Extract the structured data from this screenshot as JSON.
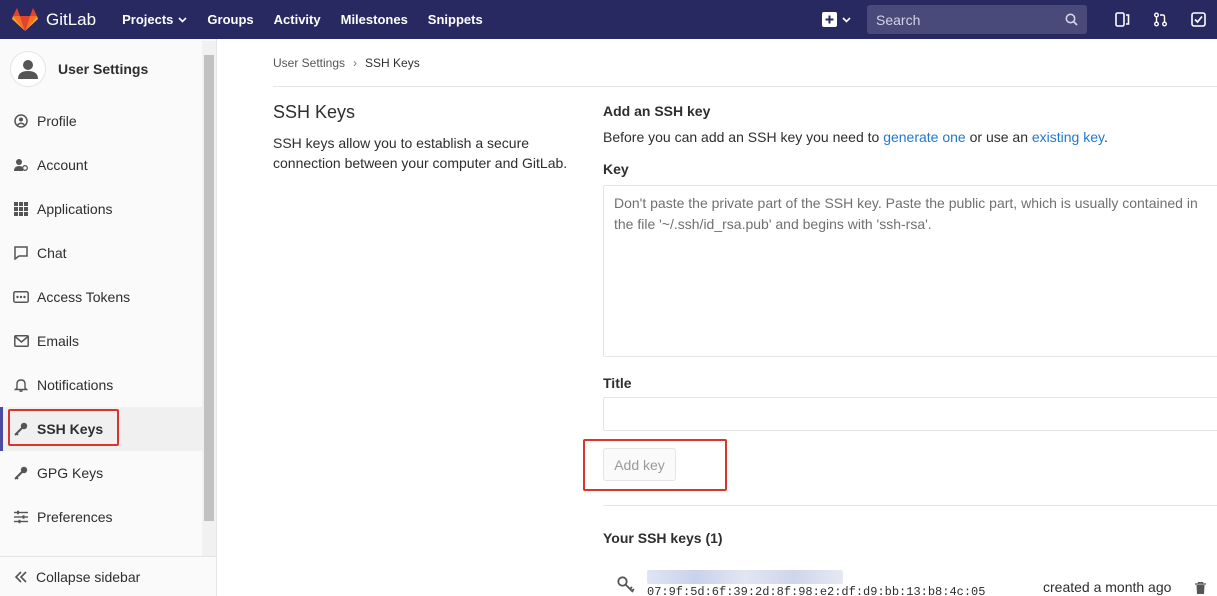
{
  "topnav": {
    "brand": "GitLab",
    "links": [
      {
        "label": "Projects",
        "has_dropdown": true
      },
      {
        "label": "Groups"
      },
      {
        "label": "Activity"
      },
      {
        "label": "Milestones"
      },
      {
        "label": "Snippets"
      }
    ],
    "search_placeholder": "Search",
    "colors": {
      "background": "#292961",
      "logo": "#e2432a"
    }
  },
  "sidebar": {
    "title": "User Settings",
    "items": [
      {
        "label": "Profile",
        "icon": "profile-icon"
      },
      {
        "label": "Account",
        "icon": "account-icon"
      },
      {
        "label": "Applications",
        "icon": "applications-icon"
      },
      {
        "label": "Chat",
        "icon": "chat-icon"
      },
      {
        "label": "Access Tokens",
        "icon": "token-icon"
      },
      {
        "label": "Emails",
        "icon": "email-icon"
      },
      {
        "label": "Notifications",
        "icon": "bell-icon"
      },
      {
        "label": "SSH Keys",
        "icon": "key-icon",
        "active": true
      },
      {
        "label": "GPG Keys",
        "icon": "key-icon"
      },
      {
        "label": "Preferences",
        "icon": "preferences-icon"
      }
    ],
    "collapse_label": "Collapse sidebar"
  },
  "breadcrumb": {
    "parent": "User Settings",
    "separator": "›",
    "current": "SSH Keys"
  },
  "intro": {
    "title": "SSH Keys",
    "description": "SSH keys allow you to establish a secure connection between your computer and GitLab."
  },
  "form": {
    "heading": "Add an SSH key",
    "desc_prefix": "Before you can add an SSH key you need to ",
    "link_generate": "generate one",
    "desc_middle": " or use an ",
    "link_existing": "existing key",
    "desc_suffix": ".",
    "key_label": "Key",
    "key_placeholder": "Don't paste the private part of the SSH key. Paste the public part, which is usually contained in the file '~/.ssh/id_rsa.pub' and begins with 'ssh-rsa'.",
    "title_label": "Title",
    "title_value": "",
    "add_button": "Add key"
  },
  "keys": {
    "heading": "Your SSH keys (1)",
    "items": [
      {
        "fingerprint": "07:9f:5d:6f:39:2d:8f:98:e2:df:d9:bb:13:b8:4c:05",
        "created": "created a month ago"
      }
    ]
  },
  "colors": {
    "highlight": "#d9352a",
    "link": "#1f78d1",
    "active_bar": "#4b4ba3"
  }
}
